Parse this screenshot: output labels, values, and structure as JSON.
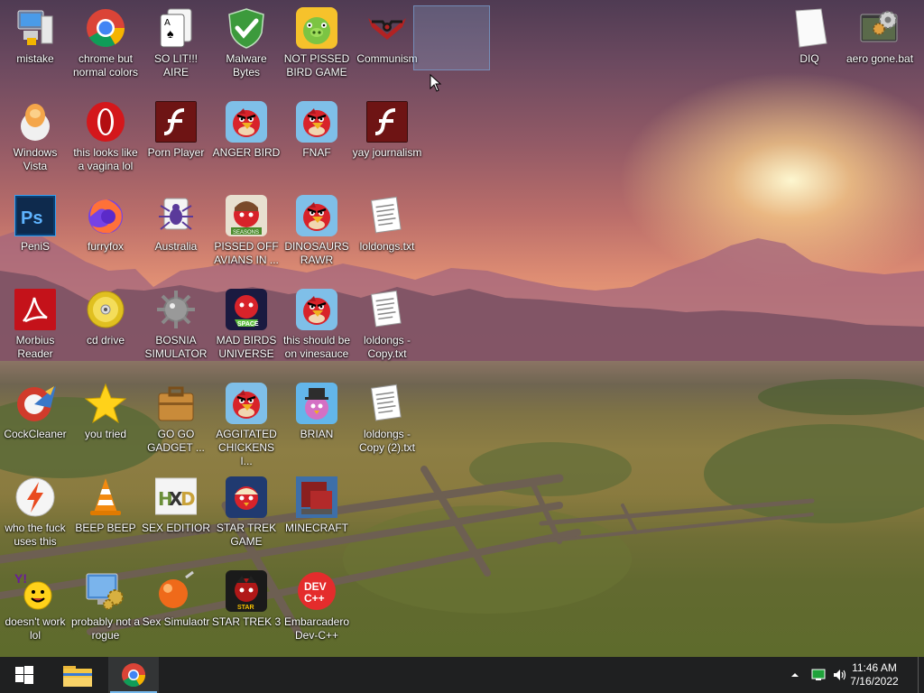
{
  "desktop": {
    "icons": [
      {
        "label": "mistake",
        "icon": "network-computer-icon"
      },
      {
        "label": "chrome but normal colors",
        "icon": "chrome-icon"
      },
      {
        "label": "SO LIT!!! AIRE",
        "icon": "solitaire-cards-icon"
      },
      {
        "label": "Malware Bytes",
        "icon": "shield-check-icon"
      },
      {
        "label": "NOT PISSED BIRD GAME",
        "icon": "green-pig-icon"
      },
      {
        "label": "Communism",
        "icon": "communism-emblem-icon"
      },
      {
        "label": "DIQ",
        "icon": "blank-document-icon"
      },
      {
        "label": "aero gone.bat",
        "icon": "batch-gear-icon"
      },
      {
        "label": "Windows Vista",
        "icon": "egg-icon"
      },
      {
        "label": "this looks like a vagina lol",
        "icon": "opera-icon"
      },
      {
        "label": "Porn Player",
        "icon": "flash-player-icon"
      },
      {
        "label": "ANGER BIRD",
        "icon": "angry-bird-icon"
      },
      {
        "label": "FNAF",
        "icon": "angry-bird-icon"
      },
      {
        "label": "yay journalism",
        "icon": "flash-player-icon"
      },
      {
        "label": "PeniS",
        "icon": "photoshop-icon"
      },
      {
        "label": "furryfox",
        "icon": "firefox-icon"
      },
      {
        "label": "Australia",
        "icon": "spider-solitaire-icon"
      },
      {
        "label": "PISSED OFF AVIANS IN ...",
        "icon": "angry-birds-seasons-icon"
      },
      {
        "label": "DINOSAURS RAWR",
        "icon": "angry-bird-icon"
      },
      {
        "label": "loldongs.txt",
        "icon": "text-file-icon"
      },
      {
        "label": "Morbius Reader",
        "icon": "pdf-reader-icon"
      },
      {
        "label": "cd drive",
        "icon": "cd-icon"
      },
      {
        "label": "BOSNIA SIMULATOR",
        "icon": "minesweeper-mine-icon"
      },
      {
        "label": "MAD BIRDS UNIVERSE",
        "icon": "angry-birds-space-icon"
      },
      {
        "label": "this should be on vinesauce",
        "icon": "angry-bird-icon"
      },
      {
        "label": "loldongs - Copy.txt",
        "icon": "text-file-icon"
      },
      {
        "label": "CockCleaner",
        "icon": "ccleaner-icon"
      },
      {
        "label": "you tried",
        "icon": "star-icon"
      },
      {
        "label": "GO GO GADGET ...",
        "icon": "briefcase-icon"
      },
      {
        "label": "AGGITATED CHICKENS I...",
        "icon": "angry-bird-icon"
      },
      {
        "label": "BRIAN",
        "icon": "pink-bird-icon"
      },
      {
        "label": "loldongs - Copy (2).txt",
        "icon": "text-file-icon"
      },
      {
        "label": "who the fuck uses this",
        "icon": "lightning-icon"
      },
      {
        "label": "BEEP BEEP",
        "icon": "vlc-cone-icon"
      },
      {
        "label": "SEX EDITIOR",
        "icon": "hxd-editor-icon"
      },
      {
        "label": "STAR TREK GAME",
        "icon": "angry-birds-star-wars-icon"
      },
      {
        "label": "MINECRAFT",
        "icon": "minecraft-icon"
      },
      {
        "label": "doesn't work lol",
        "icon": "yahoo-messenger-icon"
      },
      {
        "label": "probably not a rogue",
        "icon": "monitor-gears-icon"
      },
      {
        "label": "Sex Simulaotr",
        "icon": "orange-ball-icon"
      },
      {
        "label": "STAR TREK 3",
        "icon": "angry-birds-star-wars-2-icon"
      },
      {
        "label": "Embarcadero Dev-C++",
        "icon": "dev-cpp-icon"
      }
    ]
  },
  "taskbar": {
    "start": "windows-start-icon",
    "pinned": [
      {
        "name": "file-explorer-icon",
        "active": false
      },
      {
        "name": "chrome-icon",
        "active": true
      }
    ],
    "tray": [
      "show-hidden-icons-chevron",
      "network-icon",
      "volume-icon"
    ],
    "clock": {
      "time": "11:46 AM",
      "date": "7/16/2022"
    }
  },
  "colors": {
    "taskbar": "#1f2021",
    "accent": "#76b9ed"
  }
}
